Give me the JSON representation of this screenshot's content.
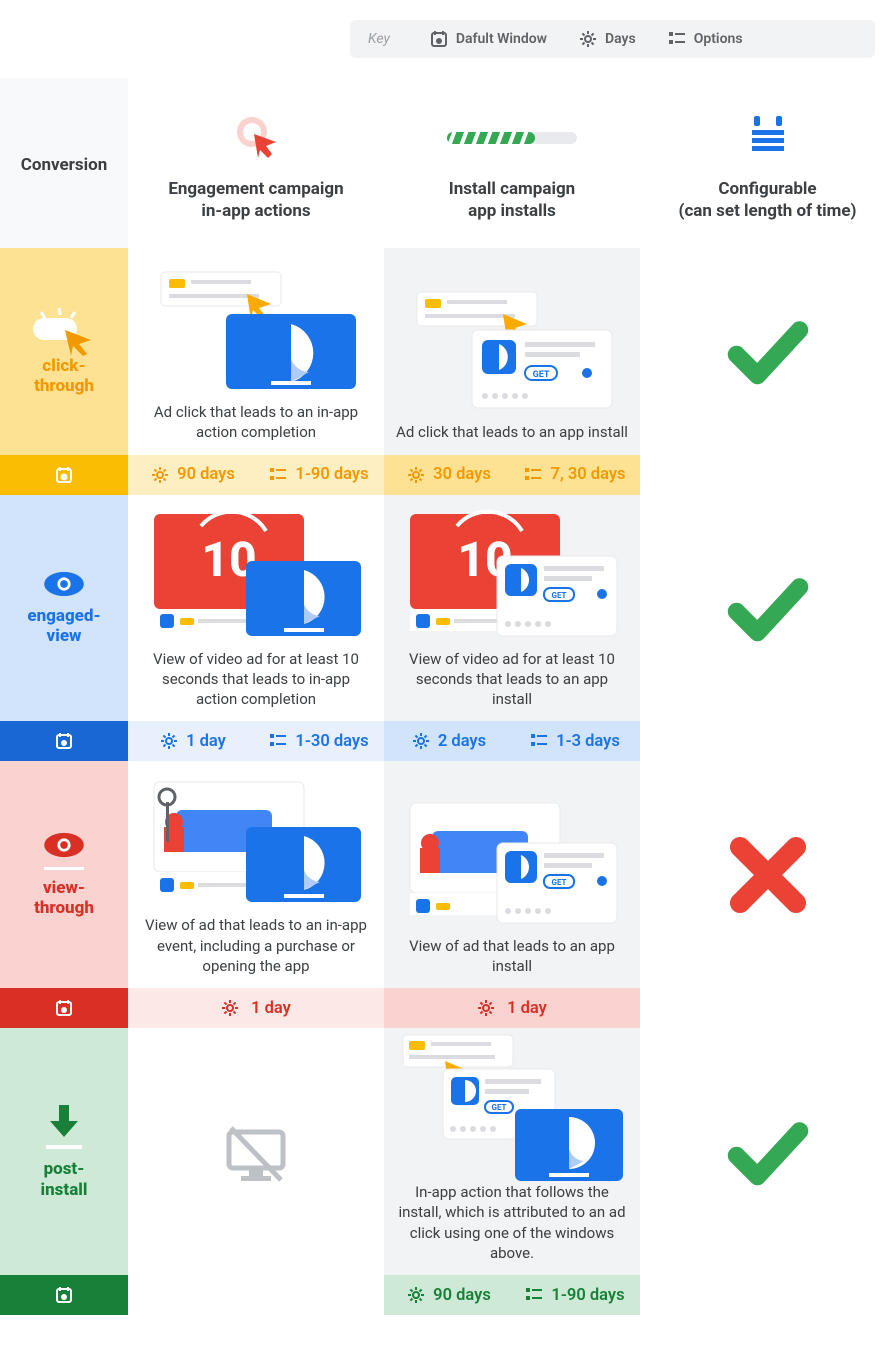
{
  "legend": {
    "key": "Key",
    "defaultWindow": "Dafult Window",
    "days": "Days",
    "options": "Options"
  },
  "headers": {
    "conversion": "Conversion",
    "engagement": {
      "line1": "Engagement campaign",
      "line2": "in-app actions"
    },
    "install": {
      "line1": "Install campaign",
      "line2": "app installs"
    },
    "configurable": {
      "line1": "Configurable",
      "line2": "(can set length of time)"
    }
  },
  "rows": {
    "clickThrough": {
      "label1": "click-",
      "label2": "through",
      "descEngagement": "Ad click that leads to an in-app action completion",
      "descInstall": "Ad click that leads to an app install",
      "bars": {
        "eng_default": "90 days",
        "eng_options": "1-90 days",
        "inst_default": "30 days",
        "inst_options": "7, 30 days"
      },
      "configurable": true
    },
    "engagedView": {
      "label1": "engaged-",
      "label2": "view",
      "descEngagement": "View of video ad for at least 10 seconds that leads to in-app action completion",
      "descInstall": "View of video ad for at least 10 seconds that leads to an app install",
      "bars": {
        "eng_default": "1 day",
        "eng_options": "1-30 days",
        "inst_default": "2 days",
        "inst_options": "1-3 days"
      },
      "configurable": true
    },
    "viewThrough": {
      "label1": "view-",
      "label2": "through",
      "descEngagement": "View of ad that leads to an in-app event, including a purchase or opening the app",
      "descInstall": "View of ad that leads to an app install",
      "bars": {
        "eng_default": "1 day",
        "inst_default": "1 day"
      },
      "configurable": false
    },
    "postInstall": {
      "label1": "post-",
      "label2": "install",
      "descInstall": "In-app action that follows the install, which is attributed to an ad click using one of the windows above.",
      "bars": {
        "inst_default": "90 days",
        "inst_options": "1-90 days"
      },
      "configurable": true
    }
  }
}
